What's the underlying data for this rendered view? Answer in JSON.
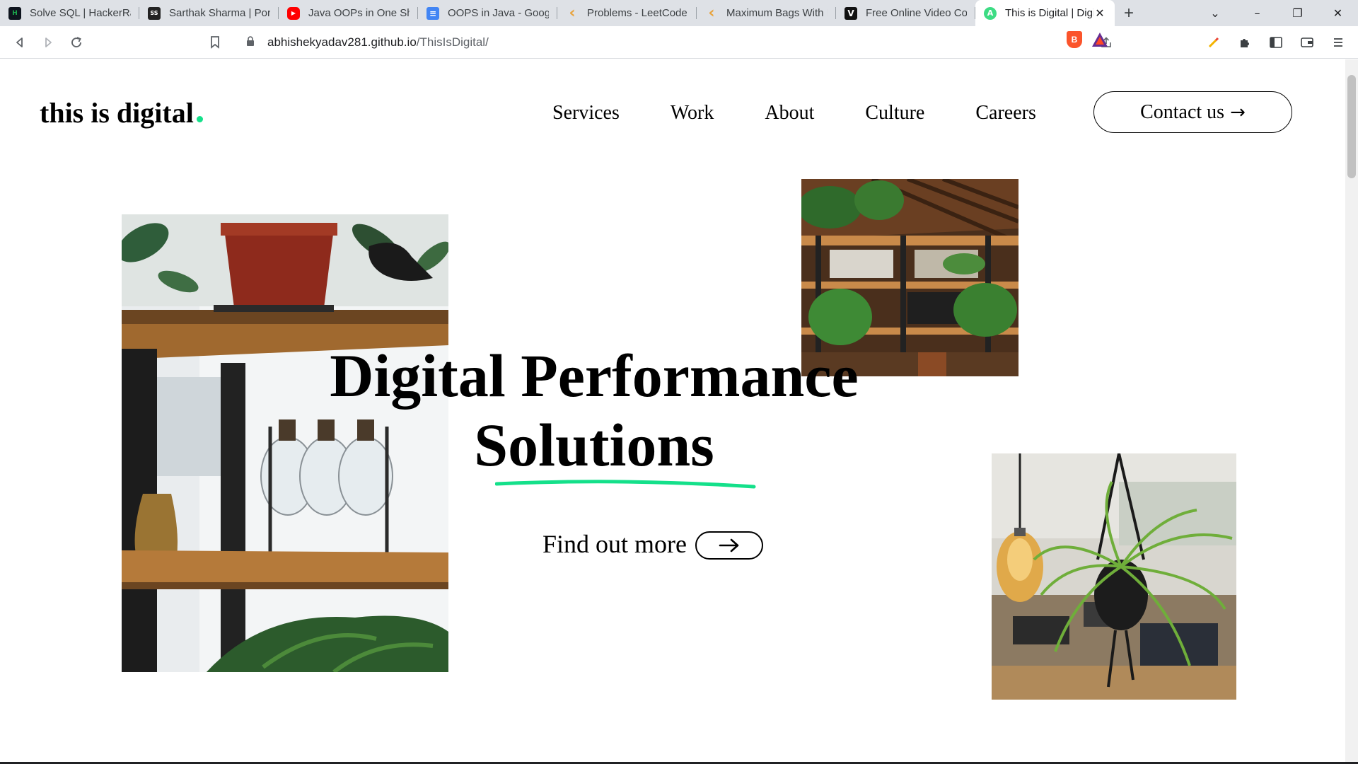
{
  "browser": {
    "tabs": [
      {
        "title": "Solve SQL | HackerRank",
        "favicon_text": "H",
        "favicon_color": "#1ba94c",
        "favicon_bg": "#0e141e"
      },
      {
        "title": "Sarthak Sharma | Portfolio",
        "favicon_text": "SS",
        "favicon_color": "#ffffff",
        "favicon_bg": "#222222"
      },
      {
        "title": "Java OOPs in One Shot",
        "favicon_text": "▶",
        "favicon_color": "#ffffff",
        "favicon_bg": "#ff0000"
      },
      {
        "title": "OOPS in Java - Google Docs",
        "favicon_text": "≡",
        "favicon_color": "#ffffff",
        "favicon_bg": "#4285f4"
      },
      {
        "title": "Problems - LeetCode",
        "favicon_text": "‹",
        "favicon_color": "#e8a33d",
        "favicon_bg": "transparent"
      },
      {
        "title": "Maximum Bags With Full",
        "favicon_text": "‹",
        "favicon_color": "#e8a33d",
        "favicon_bg": "transparent"
      },
      {
        "title": "Free Online Video Compressor",
        "favicon_text": "V",
        "favicon_color": "#ffffff",
        "favicon_bg": "#111111"
      },
      {
        "title": "This is Digital | Digital",
        "favicon_text": "A",
        "favicon_color": "#ffffff",
        "favicon_bg": "#3ddc84",
        "active": true
      }
    ],
    "new_tab_icon": "plus-icon",
    "url_host": "abhishekyadav281.github.io",
    "url_path": "/ThisIsDigital/"
  },
  "site": {
    "logo": "this is digital",
    "accent_color": "#14e08a",
    "nav": [
      "Services",
      "Work",
      "About",
      "Culture",
      "Careers"
    ],
    "contact_label": "Contact us",
    "hero_line1": "Digital Performance",
    "hero_line2": "Solutions",
    "cta_label": "Find out more"
  }
}
